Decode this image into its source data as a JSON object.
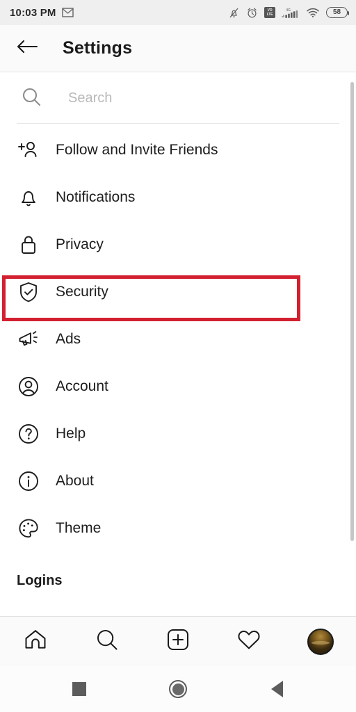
{
  "statusbar": {
    "time": "10:03 PM",
    "battery_level": "58",
    "volte_top": "VO",
    "volte_bottom": "LTE",
    "network_label": "4G",
    "icons": [
      "gmail-icon",
      "bell-muted-icon",
      "alarm-icon",
      "volte-icon",
      "signal-icon",
      "wifi-icon",
      "battery-icon"
    ]
  },
  "header": {
    "title": "Settings",
    "back_icon": "arrow-left-icon"
  },
  "search": {
    "placeholder": "Search",
    "value": "",
    "icon": "search-icon"
  },
  "menu": {
    "items": [
      {
        "label": "Follow and Invite Friends",
        "icon": "add-person-icon",
        "highlighted": false
      },
      {
        "label": "Notifications",
        "icon": "bell-icon",
        "highlighted": false
      },
      {
        "label": "Privacy",
        "icon": "lock-icon",
        "highlighted": false
      },
      {
        "label": "Security",
        "icon": "shield-check-icon",
        "highlighted": true
      },
      {
        "label": "Ads",
        "icon": "megaphone-icon",
        "highlighted": false
      },
      {
        "label": "Account",
        "icon": "account-circle-icon",
        "highlighted": false
      },
      {
        "label": "Help",
        "icon": "question-circle-icon",
        "highlighted": false
      },
      {
        "label": "About",
        "icon": "info-circle-icon",
        "highlighted": false
      },
      {
        "label": "Theme",
        "icon": "palette-icon",
        "highlighted": false
      }
    ],
    "section_header": "Logins"
  },
  "highlight": {
    "color": "#d32030",
    "target": "Security"
  },
  "tabbar": {
    "items": [
      {
        "name": "home",
        "icon": "home-icon"
      },
      {
        "name": "search",
        "icon": "search-icon"
      },
      {
        "name": "create",
        "icon": "plus-square-icon"
      },
      {
        "name": "activity",
        "icon": "heart-icon"
      },
      {
        "name": "profile",
        "icon": "avatar-icon"
      }
    ]
  },
  "navbar": {
    "items": [
      {
        "name": "recents",
        "icon": "square-icon"
      },
      {
        "name": "home",
        "icon": "circle-icon"
      },
      {
        "name": "back",
        "icon": "triangle-left-icon"
      }
    ]
  },
  "colors": {
    "accent_highlight": "#d32030",
    "statusbar_bg": "#efefef",
    "header_bg": "#fafafa",
    "text": "#1d1d1d"
  }
}
